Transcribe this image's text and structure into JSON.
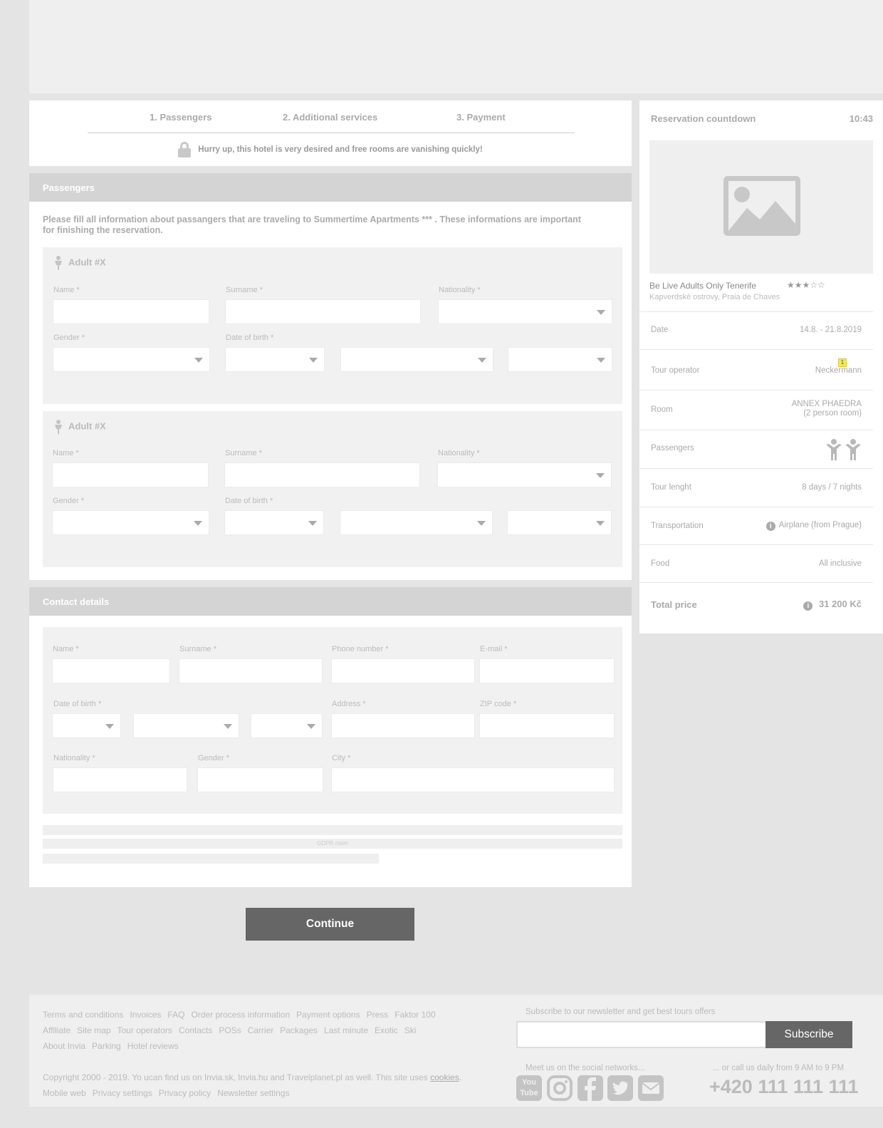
{
  "steps": [
    "1. Passengers",
    "2. Additional services",
    "3. Payment"
  ],
  "hurry_text": "Hurry up, this hotel is very desired and free rooms are vanishing quickly!",
  "passengers": {
    "title": "Passengers",
    "intro": "Please fill all information about passangers that are traveling to Summertime Apartments *** . These informations are important for finishing the reservation.",
    "adult_title": "Adult #X",
    "labels": {
      "name": "Name *",
      "surname": "Surname *",
      "nationality": "Nationality *",
      "gender": "Gender *",
      "dob": "Date of birth *"
    }
  },
  "contact": {
    "title": "Contact details",
    "labels": {
      "name": "Name *",
      "surname": "Surname *",
      "phone": "Phone number *",
      "email": "E-mail *",
      "dob": "Date of birth *",
      "address": "Address *",
      "zip": "ZIP code *",
      "nationality": "Nationality *",
      "gender": "Gender *",
      "city": "City *"
    },
    "gdpr": "GDPR claim"
  },
  "continue_label": "Continue",
  "sidebar": {
    "countdown_label": "Reservation countdown",
    "countdown_value": "10:43",
    "hotel_name": "Be Live Adults Only Tenerife",
    "stars": "★★★☆☆",
    "hotel_location": "Kapverdské ostrovy, Praia de Chaves",
    "date_label": "Date",
    "date_value": "14.8. - 21.8.2019",
    "operator_label": "Tour operator",
    "operator_value": "Neckermann",
    "operator_badge": "1",
    "room_label": "Room",
    "room_value_1": "ANNEX PHAEDRA",
    "room_value_2": "(2 person room)",
    "passengers_label": "Passengers",
    "length_label": "Tour lenght",
    "length_value": "8 days / 7 nights",
    "transport_label": "Transportation",
    "transport_value": "Airplane (from Prague)",
    "food_label": "Food",
    "food_value": "All inclusive",
    "total_label": "Total price",
    "total_value": "31 200 Kč",
    "info_icon": "i"
  },
  "footer": {
    "links_row1": [
      "Terms and conditions",
      "Invoices",
      "FAQ",
      "Order process information",
      "Payment options",
      "Press",
      "Faktor 100"
    ],
    "links_row2": [
      "Affiliate",
      "Site map",
      "Tour operators",
      "Contacts",
      "POSs",
      "Carrier",
      "Packages",
      "Last minute",
      "Exotic",
      "Ski"
    ],
    "links_row3": [
      "About Invia",
      "Parking",
      "Hotel reviews"
    ],
    "copyright": "Copyright 2000 - 2019. Yo ucan find us on Invia.sk, Invia.hu and Travelplanet.pl as well. This site uses",
    "cookies": "cookies",
    "links_row4": [
      "Mobile web",
      "Privacy settings",
      "Privacy policy",
      "Newsletter settings"
    ],
    "newsletter_label": "Subscribe to our newsletter and get best tours offers",
    "subscribe_label": "Subscribe",
    "social_label": "Meet us on the social networks...",
    "call_label": "... or call us daily from 9 AM to 9 PM",
    "phone": "+420 111 111 111",
    "youtube_text": "You Tube"
  }
}
